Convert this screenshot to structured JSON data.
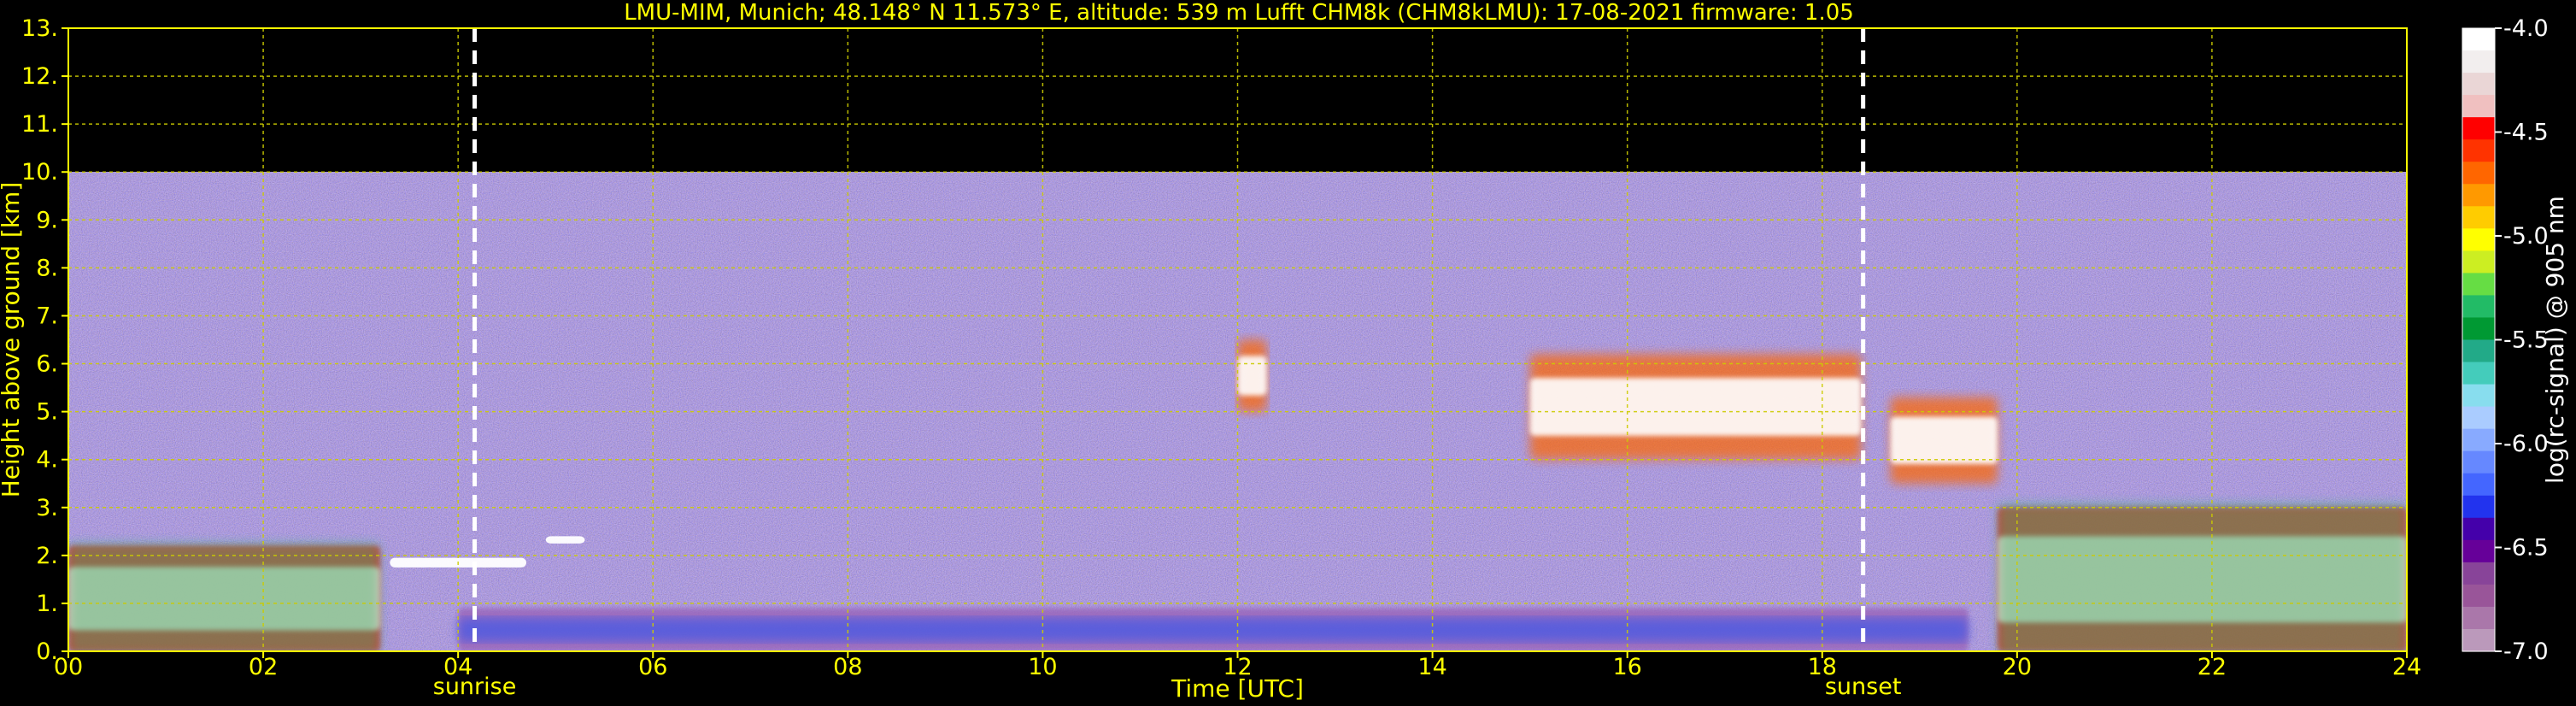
{
  "chart_data": {
    "type": "heatmap",
    "title": "LMU-MIM, Munich; 48.148° N 11.573° E, altitude: 539 m    Lufft CHM8k (CHM8kLMU): 17-08-2021    firmware: 1.05",
    "xlabel": "Time [UTC]",
    "ylabel": "Height above ground [km]",
    "xlim": [
      0,
      24
    ],
    "ylim": [
      0,
      13
    ],
    "x_ticks": [
      {
        "value": 0,
        "label": "00"
      },
      {
        "value": 2,
        "label": "02"
      },
      {
        "value": 4,
        "label": "04"
      },
      {
        "value": 6,
        "label": "06"
      },
      {
        "value": 8,
        "label": "08"
      },
      {
        "value": 10,
        "label": "10"
      },
      {
        "value": 12,
        "label": "12"
      },
      {
        "value": 14,
        "label": "14"
      },
      {
        "value": 16,
        "label": "16"
      },
      {
        "value": 18,
        "label": "18"
      },
      {
        "value": 20,
        "label": "20"
      },
      {
        "value": 22,
        "label": "22"
      },
      {
        "value": 24,
        "label": "24"
      }
    ],
    "y_ticks": [
      {
        "value": 0,
        "label": "0."
      },
      {
        "value": 1,
        "label": "1."
      },
      {
        "value": 2,
        "label": "2."
      },
      {
        "value": 3,
        "label": "3."
      },
      {
        "value": 4,
        "label": "4."
      },
      {
        "value": 5,
        "label": "5."
      },
      {
        "value": 6,
        "label": "6."
      },
      {
        "value": 7,
        "label": "7."
      },
      {
        "value": 8,
        "label": "8."
      },
      {
        "value": 9,
        "label": "9."
      },
      {
        "value": 10,
        "label": "10."
      },
      {
        "value": 11,
        "label": "11."
      },
      {
        "value": 12,
        "label": "12."
      },
      {
        "value": 13,
        "label": "13."
      }
    ],
    "grid": true,
    "data_top_km": 10,
    "markers": [
      {
        "x": 4.17,
        "label": "sunrise"
      },
      {
        "x": 18.42,
        "label": "sunset"
      }
    ],
    "features": [
      {
        "kind": "boundary_layer_aerosol",
        "x": [
          4.0,
          19.5
        ],
        "y": [
          0,
          0.9
        ]
      },
      {
        "kind": "cloud_low",
        "x": [
          0,
          3.2
        ],
        "y": [
          0,
          2.2
        ]
      },
      {
        "kind": "cloud_thin_layer",
        "x": [
          3.3,
          4.7
        ],
        "y": [
          1.75,
          1.95
        ]
      },
      {
        "kind": "cloud_thin_layer",
        "x": [
          4.9,
          5.3
        ],
        "y": [
          2.25,
          2.4
        ]
      },
      {
        "kind": "cloud_mid",
        "x": [
          12.0,
          12.3
        ],
        "y": [
          5.0,
          6.5
        ]
      },
      {
        "kind": "cloud_mid",
        "x": [
          15.0,
          18.4
        ],
        "y": [
          4.0,
          6.2
        ]
      },
      {
        "kind": "cloud_mid",
        "x": [
          18.7,
          19.8
        ],
        "y": [
          3.5,
          5.3
        ]
      },
      {
        "kind": "cloud_low",
        "x": [
          19.8,
          24.0
        ],
        "y": [
          0,
          3.0
        ]
      }
    ],
    "colorbar": {
      "label": "log(rc-signal) @ 905 nm",
      "range": [
        -7.0,
        -4.0
      ],
      "ticks": [
        {
          "value": -4.0,
          "label": "-4.0"
        },
        {
          "value": -4.5,
          "label": "-4.5"
        },
        {
          "value": -5.0,
          "label": "-5.0"
        },
        {
          "value": -5.5,
          "label": "-5.5"
        },
        {
          "value": -6.0,
          "label": "-6.0"
        },
        {
          "value": -6.5,
          "label": "-6.5"
        },
        {
          "value": -7.0,
          "label": "-7.0"
        }
      ],
      "colors": [
        "#ffffff",
        "#f2eeee",
        "#ead6d6",
        "#f0c0c0",
        "#ff0000",
        "#ff3300",
        "#ff6600",
        "#ff9900",
        "#ffcc00",
        "#ffff00",
        "#ccee22",
        "#66dd44",
        "#22bb66",
        "#009933",
        "#22aa88",
        "#44ccbb",
        "#88ddee",
        "#aaccff",
        "#88aaff",
        "#6688ff",
        "#4466ff",
        "#2233ee",
        "#4400aa",
        "#660099",
        "#884499",
        "#995599",
        "#aa77aa",
        "#bb99bb"
      ]
    }
  }
}
